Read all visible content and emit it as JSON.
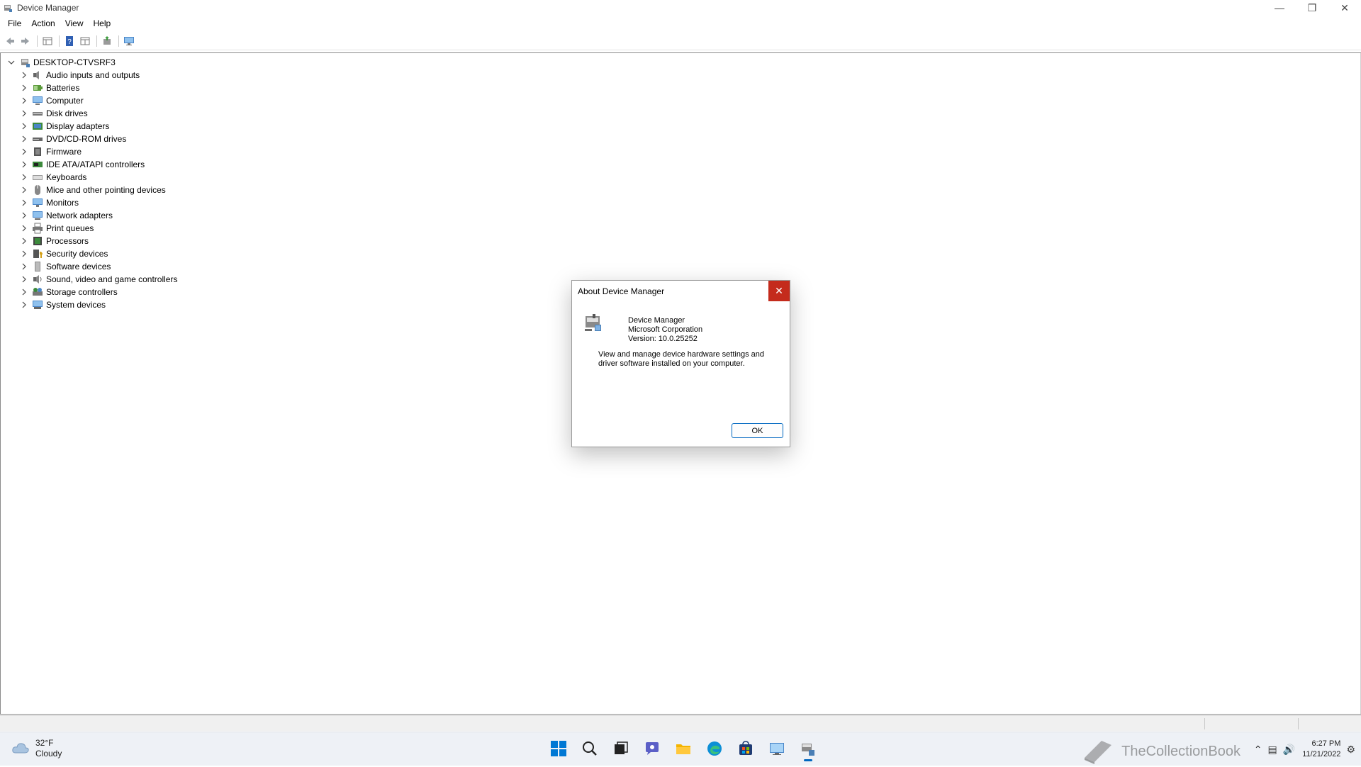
{
  "window": {
    "title": "Device Manager"
  },
  "menu": [
    "File",
    "Action",
    "View",
    "Help"
  ],
  "toolbar_icons": [
    "back-icon",
    "forward-icon",
    "properties-pane-icon",
    "help-icon",
    "view-icon",
    "update-driver-icon",
    "monitor-icon"
  ],
  "tree": {
    "root": "DESKTOP-CTVSRF3",
    "items": [
      {
        "label": "Audio inputs and outputs",
        "icon": "speaker-icon"
      },
      {
        "label": "Batteries",
        "icon": "battery-icon"
      },
      {
        "label": "Computer",
        "icon": "computer-icon"
      },
      {
        "label": "Disk drives",
        "icon": "disk-icon"
      },
      {
        "label": "Display adapters",
        "icon": "display-adapter-icon"
      },
      {
        "label": "DVD/CD-ROM drives",
        "icon": "dvd-icon"
      },
      {
        "label": "Firmware",
        "icon": "firmware-icon"
      },
      {
        "label": "IDE ATA/ATAPI controllers",
        "icon": "ide-controller-icon"
      },
      {
        "label": "Keyboards",
        "icon": "keyboard-icon"
      },
      {
        "label": "Mice and other pointing devices",
        "icon": "mouse-icon"
      },
      {
        "label": "Monitors",
        "icon": "monitor-icon"
      },
      {
        "label": "Network adapters",
        "icon": "network-icon"
      },
      {
        "label": "Print queues",
        "icon": "printer-icon"
      },
      {
        "label": "Processors",
        "icon": "processor-icon"
      },
      {
        "label": "Security devices",
        "icon": "security-icon"
      },
      {
        "label": "Software devices",
        "icon": "software-device-icon"
      },
      {
        "label": "Sound, video and game controllers",
        "icon": "sound-icon"
      },
      {
        "label": "Storage controllers",
        "icon": "storage-icon"
      },
      {
        "label": "System devices",
        "icon": "system-device-icon"
      }
    ]
  },
  "dialog": {
    "title": "About Device Manager",
    "app_name": "Device Manager",
    "company": "Microsoft Corporation",
    "version": "Version: 10.0.25252",
    "description": "View and manage device hardware settings and driver software installed on your computer.",
    "ok_label": "OK"
  },
  "taskbar": {
    "weather": {
      "temp": "32°F",
      "condition": "Cloudy"
    },
    "apps": [
      "start-icon",
      "search-icon",
      "task-view-icon",
      "chat-icon",
      "file-explorer-icon",
      "edge-icon",
      "store-icon",
      "control-panel-icon",
      "device-manager-icon"
    ],
    "watermark": "TheCollectionBook",
    "clock": {
      "time": "6:27 PM",
      "date": "11/21/2022"
    }
  },
  "colors": {
    "accent": "#0067c0",
    "close_red": "#c42b1c"
  }
}
